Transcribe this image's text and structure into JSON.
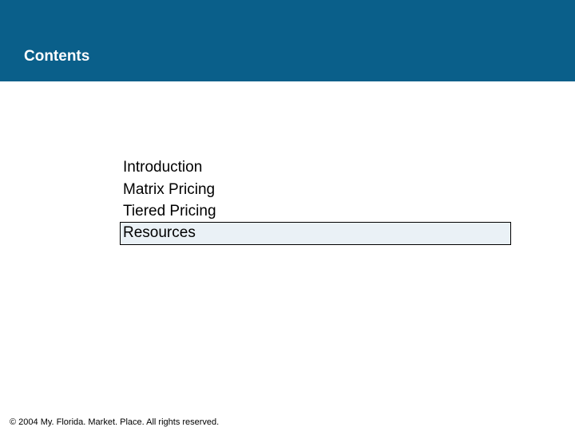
{
  "header": {
    "title": "Contents"
  },
  "toc": {
    "items": [
      {
        "label": "Introduction",
        "highlight": false
      },
      {
        "label": "Matrix Pricing",
        "highlight": false
      },
      {
        "label": "Tiered Pricing",
        "highlight": false
      },
      {
        "label": "Resources",
        "highlight": true
      }
    ]
  },
  "footer": {
    "copyright": "© 2004 My. Florida. Market. Place. All rights reserved."
  }
}
